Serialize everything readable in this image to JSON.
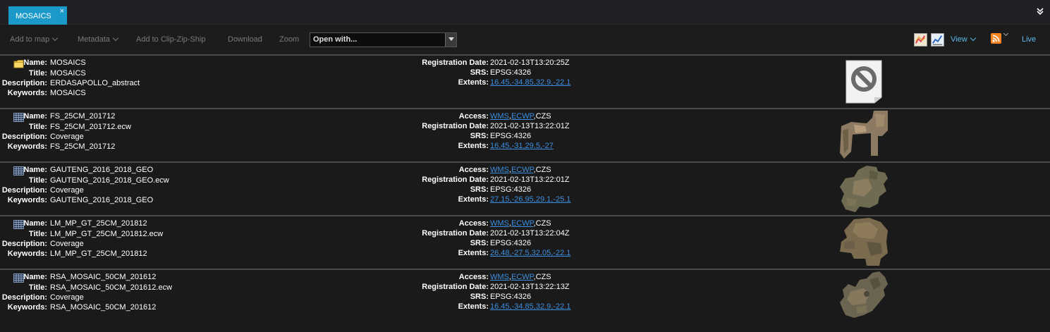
{
  "tab": {
    "label": "MOSAICS",
    "close": "×"
  },
  "toolbar": {
    "add_to_map": "Add to map",
    "metadata": "Metadata",
    "clip_zip_ship": "Add to Clip-Zip-Ship",
    "download": "Download",
    "zoom": "Zoom",
    "open_with": "Open with...",
    "view": "View",
    "live": "Live"
  },
  "labels": {
    "name": "Name:",
    "title": "Title:",
    "description": "Description:",
    "keywords": "Keywords:",
    "access": "Access:",
    "registration_date": "Registration Date:",
    "srs": "SRS:",
    "extents": "Extents:"
  },
  "items": [
    {
      "type": "folder",
      "name": "MOSAICS",
      "title": "MOSAICS",
      "description": "ERDASAPOLLO_abstract",
      "keywords": "MOSAICS",
      "registration_date": "2021-02-13T13:20:25Z",
      "srs": "EPSG:4326",
      "extents": "16.45,-34.85,32.9,-22.1",
      "thumbnail": "no-preview-icon"
    },
    {
      "type": "coverage",
      "name": "FS_25CM_201712",
      "title": "FS_25CM_201712.ecw",
      "description": "Coverage",
      "keywords": "FS_25CM_201712",
      "access_wms": "WMS",
      "access_ecwp": "ECWP",
      "access_czs": ",CZS",
      "registration_date": "2021-02-13T13:22:01Z",
      "srs": "EPSG:4326",
      "extents": "16.45,-31,29.5,-27",
      "thumbnail": "free-state-mosaic"
    },
    {
      "type": "coverage",
      "name": "GAUTENG_2016_2018_GEO",
      "title": "GAUTENG_2016_2018_GEO.ecw",
      "description": "Coverage",
      "keywords": "GAUTENG_2016_2018_GEO",
      "access_wms": "WMS",
      "access_ecwp": "ECWP",
      "access_czs": ",CZS",
      "registration_date": "2021-02-13T13:22:01Z",
      "srs": "EPSG:4326",
      "extents": "27.15,-26.95,29.1,-25.1",
      "thumbnail": "gauteng-mosaic"
    },
    {
      "type": "coverage",
      "name": "LM_MP_GT_25CM_201812",
      "title": "LM_MP_GT_25CM_201812.ecw",
      "description": "Coverage",
      "keywords": "LM_MP_GT_25CM_201812",
      "access_wms": "WMS",
      "access_ecwp": "ECWP",
      "access_czs": ",CZS",
      "registration_date": "2021-02-13T13:22:04Z",
      "srs": "EPSG:4326",
      "extents": "26.48,-27.5,32.05,-22.1",
      "thumbnail": "limpopo-mpumalanga-gauteng-mosaic"
    },
    {
      "type": "coverage",
      "name": "RSA_MOSAIC_50CM_201612",
      "title": "RSA_MOSAIC_50CM_201612.ecw",
      "description": "Coverage",
      "keywords": "RSA_MOSAIC_50CM_201612",
      "access_wms": "WMS",
      "access_ecwp": "ECWP",
      "access_czs": ",CZS",
      "registration_date": "2021-02-13T13:22:13Z",
      "srs": "EPSG:4326",
      "extents": "16.45,-34.85,32.9,-22.1",
      "thumbnail": "south-africa-mosaic"
    }
  ]
}
